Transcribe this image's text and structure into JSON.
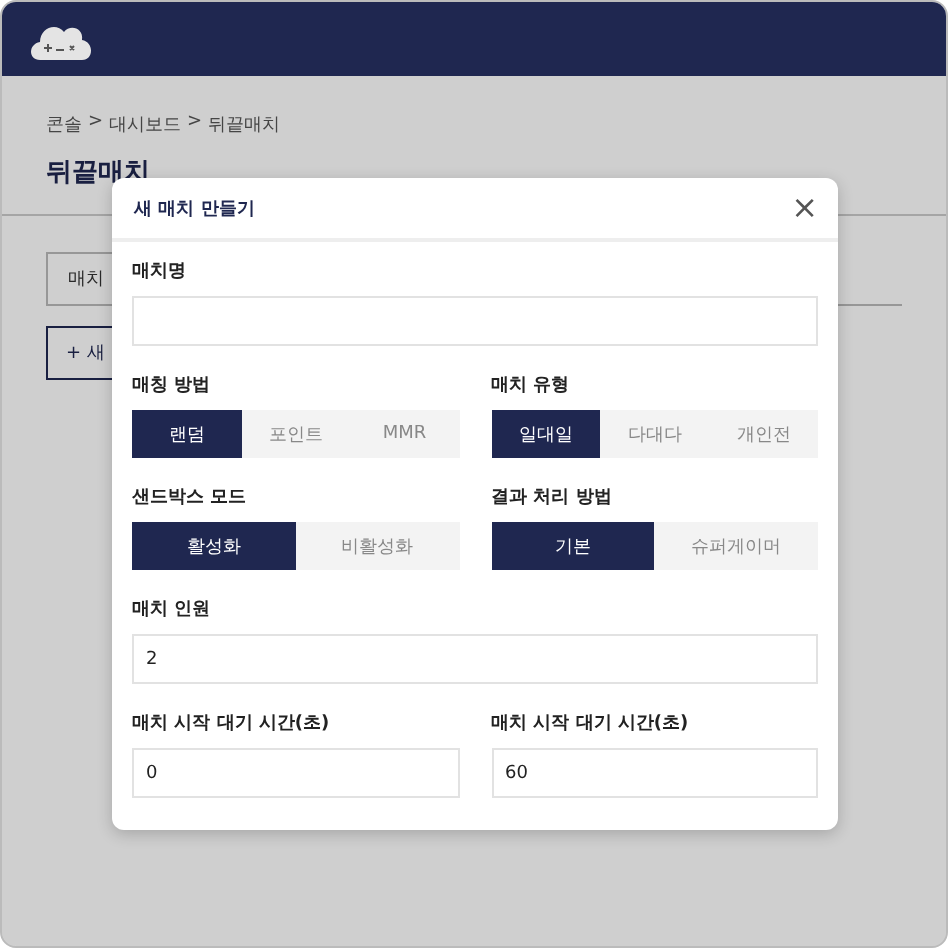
{
  "breadcrumb": [
    "콘솔",
    "대시보드",
    "뒤끝매치"
  ],
  "breadcrumb_separator": ">",
  "page_title": "뒤끝매치",
  "tab": {
    "label": "매치"
  },
  "new_button": {
    "label": "+ 새"
  },
  "modal": {
    "title": "새 매치 만들기",
    "close": "×",
    "rows": [
      {
        "fields": [
          {
            "kind": "text",
            "label": "매치명"
          }
        ]
      },
      {
        "fields": [
          {
            "kind": "choice",
            "label": "매칭 방법",
            "options": [
              {
                "label": "랜덤",
                "selected": true
              },
              {
                "label": "포인트",
                "selected": false
              },
              {
                "label": "MMR",
                "selected": false
              }
            ]
          },
          {
            "kind": "choice",
            "label": "매치 유형",
            "options": [
              {
                "label": "일대일",
                "selected": true
              },
              {
                "label": "다대다",
                "selected": false
              },
              {
                "label": "개인전",
                "selected": false
              }
            ]
          }
        ]
      },
      {
        "fields": [
          {
            "kind": "choice",
            "label": "샌드박스 모드",
            "options": [
              {
                "label": "활성화",
                "selected": true
              },
              {
                "label": "비활성화",
                "selected": false
              }
            ]
          },
          {
            "kind": "choice",
            "label": "결과 처리 방법",
            "options": [
              {
                "label": "기본",
                "selected": true
              },
              {
                "label": "슈퍼게이머",
                "selected": false
              }
            ]
          }
        ]
      },
      {
        "fields": [
          {
            "kind": "text",
            "label": "매치 인원",
            "value": "2"
          }
        ]
      },
      {
        "fields": [
          {
            "kind": "text",
            "label": "매치 시작 대기 시간(초)",
            "value": "0"
          },
          {
            "kind": "text",
            "label": "매치 시작 대기 시간(초)",
            "value": "60"
          }
        ]
      }
    ]
  }
}
